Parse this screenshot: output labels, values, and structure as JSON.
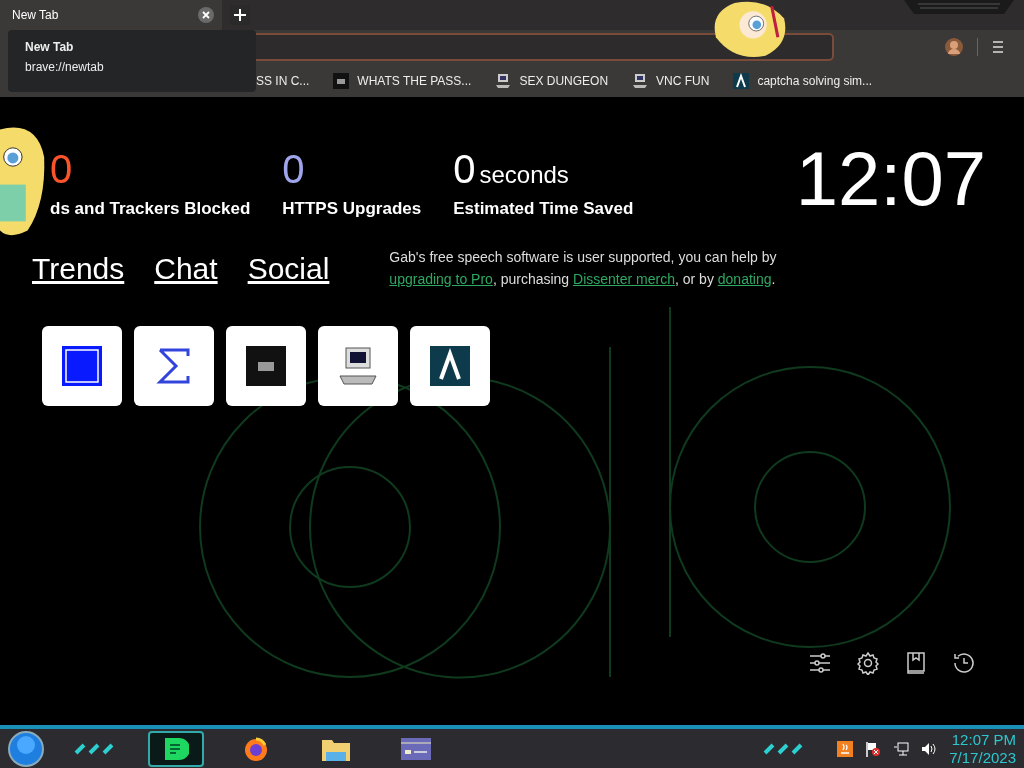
{
  "tabs": [
    {
      "title": "New Tab",
      "selected": true
    }
  ],
  "tab_tooltip": {
    "title": "New Tab",
    "url": "brave://newtab"
  },
  "bookmarks": [
    {
      "label": "SS IN C...",
      "kind": "plain"
    },
    {
      "label": "WHATS THE PASS...",
      "kind": "terminal"
    },
    {
      "label": "SEX DUNGEON",
      "kind": "computer"
    },
    {
      "label": "VNC FUN",
      "kind": "computer"
    },
    {
      "label": "captcha solving sim...",
      "kind": "caret"
    }
  ],
  "stats": [
    {
      "value": "0",
      "label": "ds and Trackers Blocked",
      "color": "#fb542b"
    },
    {
      "value": "0",
      "label": "HTTPS Upgrades",
      "color": "#a0a5eb"
    },
    {
      "value": "0",
      "unit": "seconds",
      "label": "Estimated Time Saved",
      "color": "#ffffff"
    }
  ],
  "clock": "12:07",
  "nav_links": [
    "Trends",
    "Chat",
    "Social"
  ],
  "promo": [
    {
      "kind": "text",
      "text": "Gab's free speech software is user supported, you can help by "
    },
    {
      "kind": "link",
      "text": "upgrading to Pro"
    },
    {
      "kind": "text",
      "text": ", purchasing "
    },
    {
      "kind": "link",
      "text": "Dissenter merch"
    },
    {
      "kind": "text",
      "text": ", or by "
    },
    {
      "kind": "link",
      "text": "donating"
    },
    {
      "kind": "text",
      "text": "."
    }
  ],
  "top_sites": [
    {
      "kind": "mft"
    },
    {
      "kind": "sigma"
    },
    {
      "kind": "terminal"
    },
    {
      "kind": "computer"
    },
    {
      "kind": "caret"
    }
  ],
  "taskbar": {
    "apps": [
      {
        "kind": "chat",
        "selected": true
      },
      {
        "kind": "browser",
        "selected": false
      },
      {
        "kind": "folder",
        "selected": false
      },
      {
        "kind": "window",
        "selected": false
      }
    ],
    "time": "12:07 PM",
    "date": "7/17/2023"
  }
}
